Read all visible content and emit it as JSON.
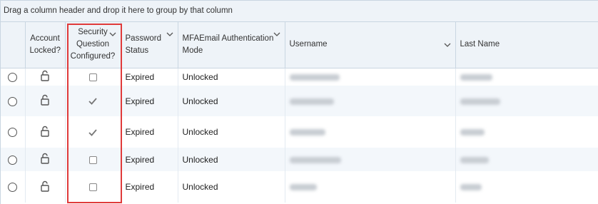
{
  "group_bar": {
    "text": "Drag a column header and drop it here to group by that column"
  },
  "columns": {
    "account_locked": "Account Locked?",
    "security_question": "Security Question Configured?",
    "password_status": "Password Status",
    "mfa_email": "MFAEmail Authentication Mode",
    "username": "Username",
    "last_name": "Last Name"
  },
  "rows": [
    {
      "password_status": "Expired",
      "mfa_mode": "Unlocked",
      "security_configured": false
    },
    {
      "password_status": "Expired",
      "mfa_mode": "Unlocked",
      "security_configured": true
    },
    {
      "password_status": "Expired",
      "mfa_mode": "Unlocked",
      "security_configured": true
    },
    {
      "password_status": "Expired",
      "mfa_mode": "Unlocked",
      "security_configured": false
    },
    {
      "password_status": "Expired",
      "mfa_mode": "Unlocked",
      "security_configured": false
    }
  ],
  "icons": {
    "lock": "unlocked-padlock-icon",
    "check": "checkmark-icon",
    "sort": "chevron-down-icon"
  },
  "colors": {
    "highlight": "#e03a3a",
    "header_bg": "#eef3f8",
    "alt_row_bg": "#f3f7fb"
  }
}
